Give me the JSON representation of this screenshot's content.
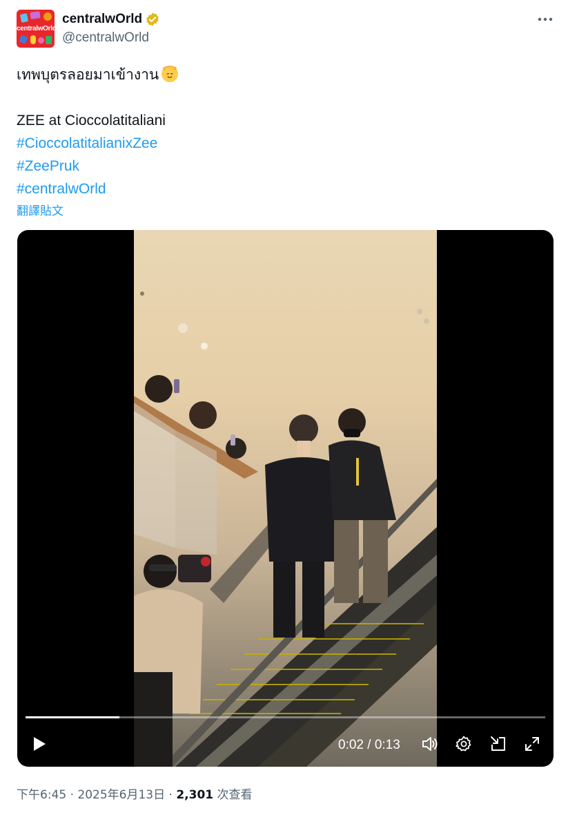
{
  "account": {
    "display_name": "centralwOrld",
    "handle": "@centralwOrld",
    "avatar_text": "centralwOrld",
    "verified_color": "#e2b719"
  },
  "post": {
    "line1": "เทพบุตรลอยมาเข้างาน",
    "line1_emoji": "angel-face",
    "line2": "ZEE at Cioccolatitaliani",
    "hashtags": [
      "#CioccolatitalianixZee",
      "#ZeePruk",
      "#centralwOrld"
    ],
    "translate_label": "翻譯貼文"
  },
  "video": {
    "current_time": "0:02",
    "separator": "/",
    "duration": "0:13",
    "progress_fraction": 0.18
  },
  "footer": {
    "time": "下午6:45",
    "dot1": "·",
    "date": "2025年6月13日",
    "dot2": "·",
    "views_count": "2,301",
    "views_label": "次查看"
  },
  "colors": {
    "link": "#1d9bf0",
    "secondary_text": "#536471",
    "brand_red": "#e8262b"
  }
}
